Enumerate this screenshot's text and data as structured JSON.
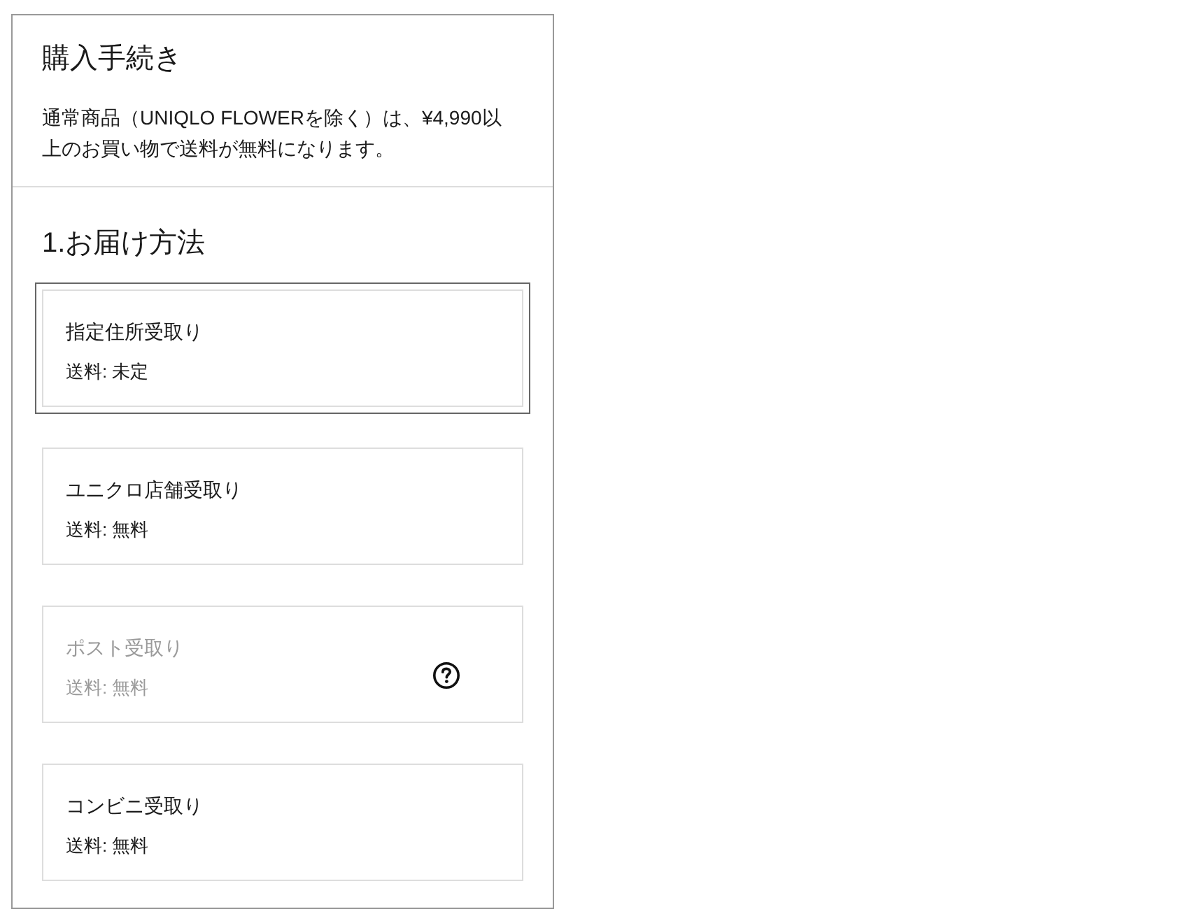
{
  "header": {
    "title": "購入手続き",
    "note": "通常商品（UNIQLO FLOWERを除く）は、¥4,990以上のお買い物で送料が無料になります。"
  },
  "section": {
    "heading": "1.お届け方法"
  },
  "options": [
    {
      "name": "指定住所受取り",
      "fee": "送料: 未定",
      "selected": true,
      "disabled": false,
      "help": false
    },
    {
      "name": "ユニクロ店舗受取り",
      "fee": "送料: 無料",
      "selected": false,
      "disabled": false,
      "help": false
    },
    {
      "name": "ポスト受取り",
      "fee": "送料: 無料",
      "selected": false,
      "disabled": true,
      "help": true
    },
    {
      "name": "コンビニ受取り",
      "fee": "送料: 無料",
      "selected": false,
      "disabled": false,
      "help": false
    }
  ]
}
